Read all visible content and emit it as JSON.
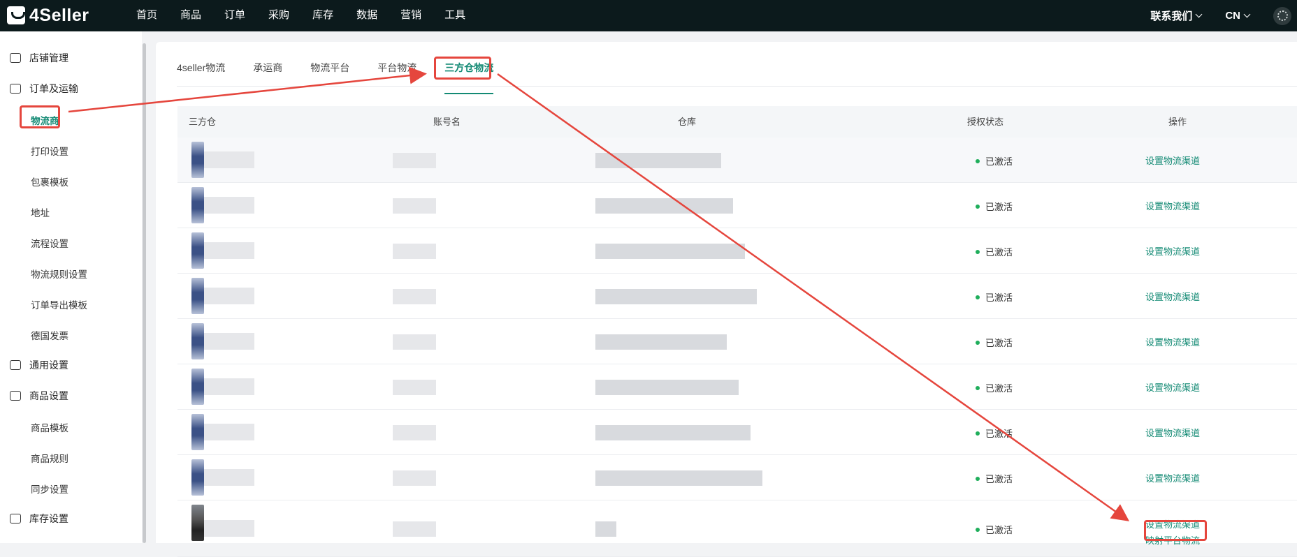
{
  "header": {
    "logo_text": "4Seller",
    "nav": [
      "首页",
      "商品",
      "订单",
      "采购",
      "库存",
      "数据",
      "营销",
      "工具"
    ],
    "contact_label": "联系我们",
    "lang_label": "CN"
  },
  "sidebar": {
    "groups": [
      {
        "label": "店铺管理",
        "icon": "store-icon"
      },
      {
        "label": "订单及运输",
        "icon": "order-icon"
      },
      {
        "label": "通用设置",
        "icon": "printer-icon"
      },
      {
        "label": "商品设置",
        "icon": "upload-box-icon"
      },
      {
        "label": "库存设置",
        "icon": "inventory-icon"
      }
    ],
    "order_items": [
      "物流商",
      "打印设置",
      "包裹模板",
      "地址",
      "流程设置",
      "物流规则设置",
      "订单导出模板",
      "德国发票"
    ],
    "product_items": [
      "商品模板",
      "商品规则",
      "同步设置"
    ]
  },
  "tabs": [
    "4seller物流",
    "承运商",
    "物流平台",
    "平台物流",
    "三方仓物流"
  ],
  "table": {
    "columns": [
      "三方仓",
      "账号名",
      "仓库",
      "授权状态",
      "操作"
    ],
    "status_label": "已激活",
    "action_label": "设置物流渠道",
    "extra_action_label": "映射平台物流",
    "row_count": 9
  },
  "colors": {
    "accent": "#138a74",
    "topbar": "#0c1a1c",
    "highlight": "#e5463d",
    "status_active": "#1fae5b"
  }
}
